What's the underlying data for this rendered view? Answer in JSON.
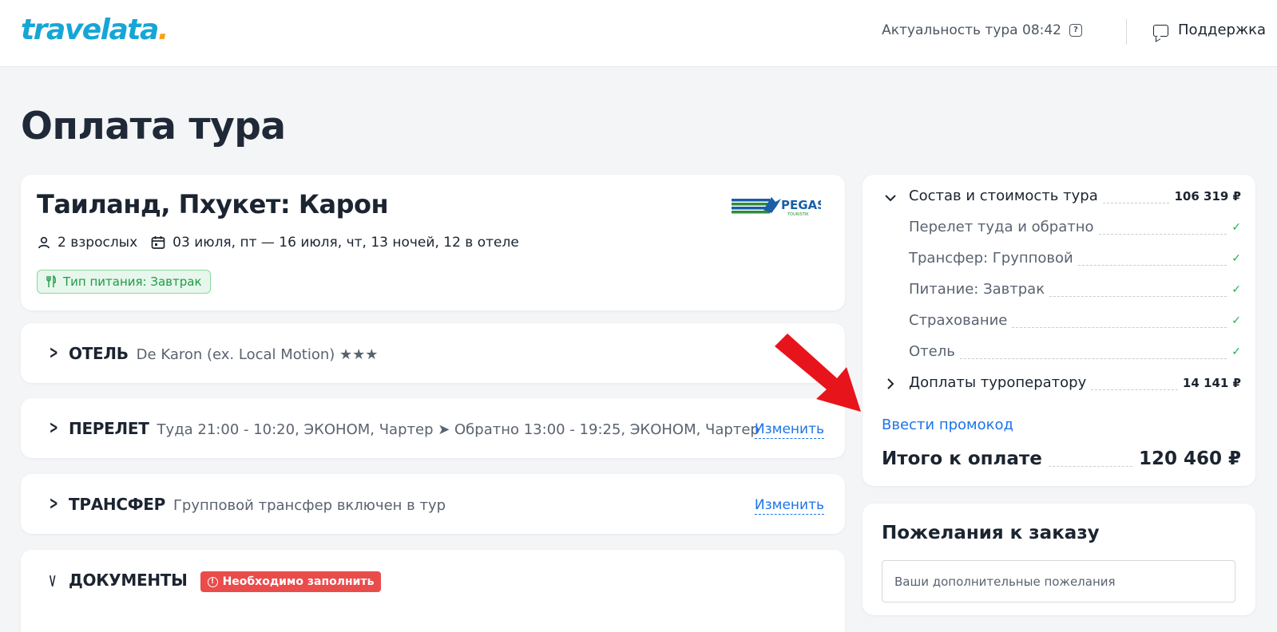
{
  "header": {
    "logo_text": "travelata",
    "logo_dot": ".",
    "actuality_label": "Актуальность тура 08:42",
    "help_icon": "question-icon",
    "support_label": "Поддержка",
    "support_icon": "chat-icon"
  },
  "page_title": "Оплата тура",
  "tour": {
    "title": "Таиланд, Пхукет: Карон",
    "operator_logo": "PEGAS",
    "operator_logo_sub": "TOURISTIK",
    "guests": "2 взрослых",
    "dates": "03 июля, пт — 16 июля, чт, 13 ночей, 12 в отеле",
    "meal": "Тип питания: Завтрак"
  },
  "sections": {
    "hotel": {
      "name": "ОТЕЛЬ",
      "desc": "De Karon (ex. Local Motion) ★★★"
    },
    "flight": {
      "name": "ПЕРЕЛЕТ",
      "desc": "Туда 21:00 - 10:20, ЭКОНОМ, Чартер ➤ Обратно 13:00 - 19:25, ЭКОНОМ, Чартер",
      "change": "Изменить"
    },
    "transfer": {
      "name": "ТРАНСФЕР",
      "desc": "Групповой трансфер включен в тур",
      "change": "Изменить"
    },
    "documents": {
      "name": "ДОКУМЕНТЫ",
      "badge": "Необходимо заполнить"
    }
  },
  "summary": {
    "composition_label": "Состав и стоимость тура",
    "composition_value": "106 319 ₽",
    "items": [
      {
        "label": "Перелет туда и обратно",
        "check": "✓"
      },
      {
        "label": "Трансфер: Групповой",
        "check": "✓"
      },
      {
        "label": "Питание: Завтрак",
        "check": "✓"
      },
      {
        "label": "Страхование",
        "check": "✓"
      },
      {
        "label": "Отель",
        "check": "✓"
      }
    ],
    "extra_label": "Доплаты туроператору",
    "extra_value": "14 141 ₽",
    "promo_link": "Ввести промокод",
    "total_label": "Итого к оплате",
    "total_value": "120 460 ₽"
  },
  "wishes": {
    "title": "Пожелания к заказу",
    "placeholder": "Ваши дополнительные пожелания",
    "value": ""
  },
  "colors": {
    "accent_blue": "#1d74e8",
    "logo_blue": "#16a6d6",
    "logo_orange": "#f7a11a",
    "success_green": "#1fae55",
    "danger_red": "#ea4b4b",
    "annotation_arrow": "#e8141b"
  }
}
